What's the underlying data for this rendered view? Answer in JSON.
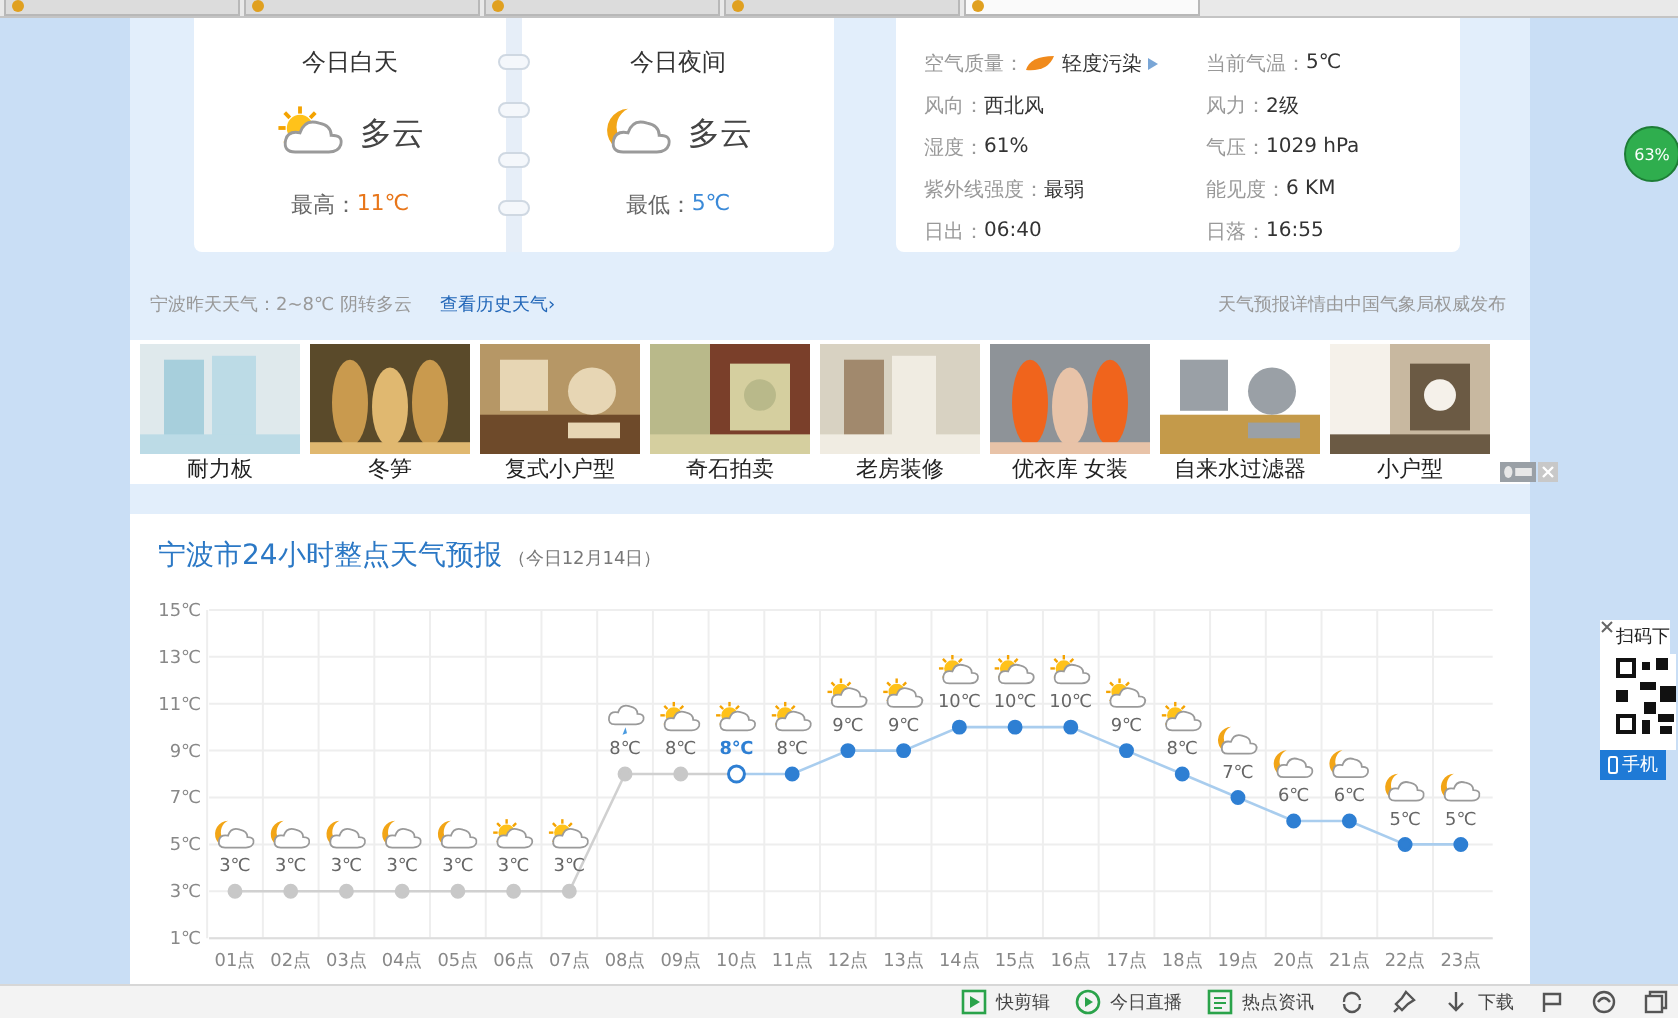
{
  "browser_tabs": [
    {
      "selected": false
    },
    {
      "selected": false
    },
    {
      "selected": false
    },
    {
      "selected": false
    },
    {
      "selected": true
    }
  ],
  "periods": [
    {
      "kind": "day",
      "title": "今日白天",
      "weather": "多云",
      "temp_label": "最高：",
      "temp": "11℃"
    },
    {
      "kind": "night",
      "title": "今日夜间",
      "weather": "多云",
      "temp_label": "最低：",
      "temp": "5℃"
    }
  ],
  "details": [
    {
      "kind": "air",
      "label": "空气质量：",
      "value": "轻度污染"
    },
    {
      "kind": "plain",
      "label": "当前气温：",
      "value": "5℃"
    },
    {
      "kind": "plain",
      "label": "风向：",
      "value": "西北风"
    },
    {
      "kind": "plain",
      "label": "风力：",
      "value": "2级"
    },
    {
      "kind": "plain",
      "label": "湿度：",
      "value": "61%"
    },
    {
      "kind": "plain",
      "label": "气压：",
      "value": "1029 hPa"
    },
    {
      "kind": "plain",
      "label": "紫外线强度：",
      "value": "最弱"
    },
    {
      "kind": "plain",
      "label": "能见度：",
      "value": "6 KM"
    },
    {
      "kind": "plain",
      "label": "日出：",
      "value": "06:40"
    },
    {
      "kind": "plain",
      "label": "日落：",
      "value": "16:55"
    }
  ],
  "yesterday": "宁波昨天天气：2~8℃  阴转多云",
  "history_link": "查看历史天气›",
  "source": "天气预报详情由中国气象局权威发布",
  "ads": [
    {
      "caption": "耐力板",
      "kind": "picture"
    },
    {
      "caption": "冬笋",
      "kind": "picture"
    },
    {
      "caption": "复式小户型",
      "kind": "picture"
    },
    {
      "caption": "奇石拍卖",
      "kind": "picture"
    },
    {
      "caption": "老房装修",
      "kind": "picture"
    },
    {
      "caption": "优衣库 女装",
      "kind": "picture"
    },
    {
      "caption": "自来水过滤器",
      "kind": "picture"
    },
    {
      "caption": "小户型",
      "kind": "picture"
    }
  ],
  "forecast": {
    "title": "宁波市24小时整点天气预报",
    "date": "（今日12月14日）",
    "chart_data": {
      "type": "line",
      "grid": true,
      "categories": [
        "01点",
        "02点",
        "03点",
        "04点",
        "05点",
        "06点",
        "07点",
        "08点",
        "09点",
        "10点",
        "11点",
        "12点",
        "13点",
        "14点",
        "15点",
        "16点",
        "17点",
        "18点",
        "19点",
        "20点",
        "21点",
        "22点",
        "23点"
      ],
      "series": [
        {
          "color": "#2e7fd3",
          "marker": "circle",
          "values": [
            3,
            3,
            3,
            3,
            3,
            3,
            3,
            8,
            8,
            8,
            8,
            9,
            9,
            10,
            10,
            10,
            9,
            8,
            7,
            6,
            6,
            5,
            5
          ]
        }
      ],
      "ylim": [
        1,
        15
      ],
      "yticks": [
        {
          "value": 15,
          "label": "15℃"
        },
        {
          "value": 13,
          "label": "13℃"
        },
        {
          "value": 11,
          "label": "11℃"
        },
        {
          "value": 9,
          "label": "9℃"
        },
        {
          "value": 7,
          "label": "7℃"
        },
        {
          "value": 5,
          "label": "5℃"
        },
        {
          "value": 3,
          "label": "3℃"
        },
        {
          "value": 1,
          "label": "1℃"
        }
      ],
      "value_labels": [
        "3℃",
        "3℃",
        "3℃",
        "3℃",
        "3℃",
        "3℃",
        "3℃",
        "8℃",
        "8℃",
        "8℃",
        "8℃",
        "9℃",
        "9℃",
        "10℃",
        "10℃",
        "10℃",
        "9℃",
        "8℃",
        "7℃",
        "6℃",
        "6℃",
        "5℃",
        "5℃"
      ]
    },
    "hours": [
      {
        "kind": "night",
        "past": true,
        "selected": false
      },
      {
        "kind": "night",
        "past": true,
        "selected": false
      },
      {
        "kind": "night",
        "past": true,
        "selected": false
      },
      {
        "kind": "night",
        "past": true,
        "selected": false
      },
      {
        "kind": "night",
        "past": true,
        "selected": false
      },
      {
        "kind": "day",
        "past": true,
        "selected": false
      },
      {
        "kind": "day",
        "past": true,
        "selected": false
      },
      {
        "kind": "rain",
        "past": true,
        "selected": false
      },
      {
        "kind": "day",
        "past": true,
        "selected": false
      },
      {
        "kind": "day",
        "past": false,
        "selected": true
      },
      {
        "kind": "day",
        "past": false,
        "selected": false
      },
      {
        "kind": "day",
        "past": false,
        "selected": false
      },
      {
        "kind": "day",
        "past": false,
        "selected": false
      },
      {
        "kind": "day",
        "past": false,
        "selected": false
      },
      {
        "kind": "day",
        "past": false,
        "selected": false
      },
      {
        "kind": "day",
        "past": false,
        "selected": false
      },
      {
        "kind": "day",
        "past": false,
        "selected": false
      },
      {
        "kind": "day",
        "past": false,
        "selected": false
      },
      {
        "kind": "night",
        "past": false,
        "selected": false
      },
      {
        "kind": "night",
        "past": false,
        "selected": false
      },
      {
        "kind": "night",
        "past": false,
        "selected": false
      },
      {
        "kind": "night",
        "past": false,
        "selected": false
      },
      {
        "kind": "night",
        "past": false,
        "selected": false
      }
    ]
  },
  "badge": "63%",
  "qr": {
    "title": "扫码下",
    "button": "手机"
  },
  "status_bar": [
    {
      "kind": "clip",
      "label": "快剪辑"
    },
    {
      "kind": "play",
      "label": "今日直播"
    },
    {
      "kind": "news",
      "label": "热点资讯"
    },
    {
      "kind": "sync"
    },
    {
      "kind": "pin"
    },
    {
      "kind": "download",
      "label": "下载"
    },
    {
      "kind": "flag"
    },
    {
      "kind": "swirl"
    },
    {
      "kind": "window"
    }
  ]
}
